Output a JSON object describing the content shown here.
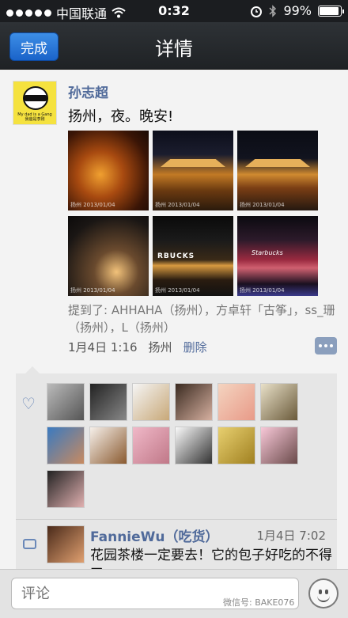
{
  "status_bar": {
    "carrier": "中国联通",
    "time": "0:32",
    "battery": "99%",
    "battery_level": 0.99,
    "icons": [
      "signal-dots-icon",
      "wifi-icon",
      "alarm-icon",
      "bluetooth-icon",
      "battery-icon"
    ]
  },
  "nav": {
    "done_label": "完成",
    "title": "详情"
  },
  "post": {
    "author": "孙志超",
    "avatar_caption_line1": "My dad is a Gang",
    "avatar_caption_line2": "我爸是李刚",
    "text": "扬州，夜。晚安!",
    "photo_captions": [
      "扬州 2013/01/04",
      "扬州 2013/01/04",
      "扬州 2013/01/04",
      "扬州 2013/01/04",
      "扬州 2013/01/04",
      "扬州 2013/01/04"
    ],
    "photo_signs": [
      "RBUCKS",
      "Starbucks"
    ],
    "mentions": "提到了: AHHAHA（扬州），方卓轩「古筝」，ss_珊（扬州），L（扬州）",
    "date": "1月4日 1:16",
    "location": "扬州",
    "delete_label": "删除"
  },
  "likes": {
    "count": 13,
    "icon": "heart-icon"
  },
  "comment": {
    "name": "FannieWu（吃货）",
    "time": "1月4日 7:02",
    "text": "花园茶楼一定要去！它的包子好吃的不得了。",
    "icon": "comment-bubble-icon"
  },
  "input_bar": {
    "placeholder": "评论",
    "watermark": "微信号: BAKE076",
    "emoji_icon": "emoji-icon"
  },
  "colors": {
    "link": "#506a9a",
    "nav_bg": "#2a2d31",
    "button_blue": "#2a76d6"
  }
}
